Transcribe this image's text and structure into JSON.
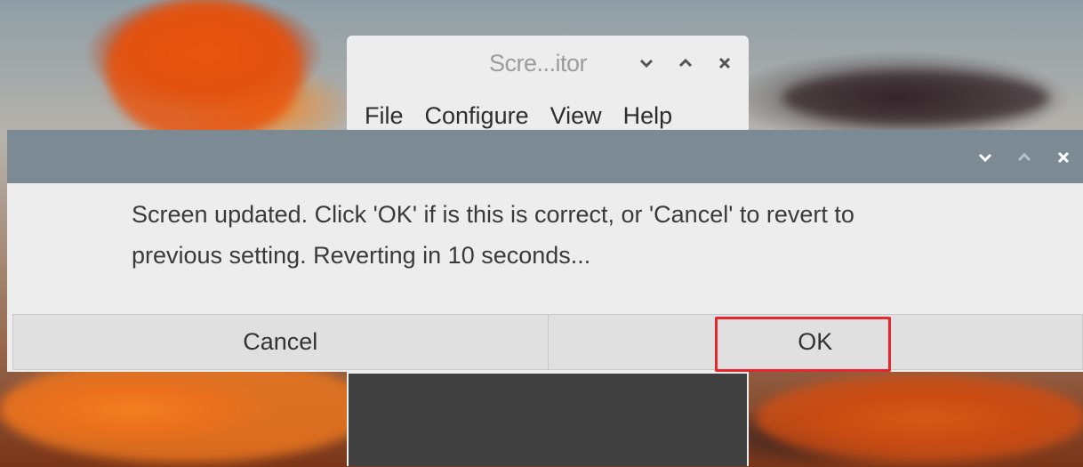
{
  "background_window": {
    "title": "Scre...itor",
    "menu": [
      "File",
      "Configure",
      "View",
      "Help"
    ],
    "controls": [
      "minimize-icon",
      "maximize-icon",
      "close-icon"
    ]
  },
  "dialog": {
    "controls": [
      "minimize-icon",
      "maximize-icon",
      "close-icon"
    ],
    "message_line1": "Screen updated. Click 'OK' if is this is correct, or 'Cancel' to revert to",
    "message_line2": "previous setting. Reverting in 10 seconds...",
    "cancel_label": "Cancel",
    "ok_label": "OK"
  },
  "colors": {
    "dialog_titlebar": "#7c8a93",
    "highlight": "#e3272d",
    "window_bg": "#ededed"
  }
}
